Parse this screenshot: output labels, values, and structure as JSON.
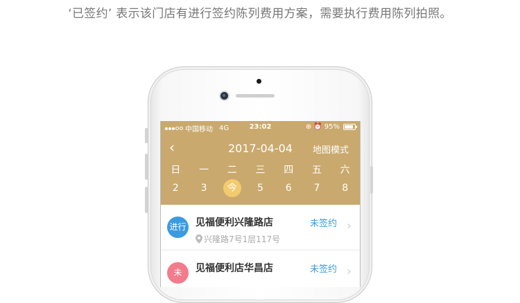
{
  "caption": "‘已签约’ 表示该门店有进行签约陈列费用方案，需要执行费用陈列拍照。",
  "status_bar": {
    "carrier": "中国移动",
    "network": "4G",
    "time": "23:02",
    "battery": "95%",
    "icons": [
      "signal-dots-icon",
      "wifi-icon",
      "lock-rotation-icon",
      "alarm-icon",
      "battery-icon"
    ]
  },
  "nav": {
    "back_icon": "‹",
    "date": "2017-04-04",
    "map_mode": "地图模式"
  },
  "week": {
    "days": [
      "日",
      "一",
      "二",
      "三",
      "四",
      "五",
      "六"
    ],
    "dates": [
      "2",
      "3",
      "今",
      "5",
      "6",
      "7",
      "8"
    ],
    "today_index": 2
  },
  "stores": [
    {
      "badge": "进行",
      "badge_color": "#3b9be0",
      "name": "见福便利兴隆路店",
      "address": "兴隆路7号1层117号",
      "status": "未签约"
    },
    {
      "badge": "未",
      "badge_color": "#f27b8c",
      "name": "见福便利店华昌店",
      "address": "",
      "status": "未签约"
    }
  ],
  "colors": {
    "header": "#c9a96d",
    "today": "#f3cb6e",
    "status_text": "#3b9be0"
  }
}
